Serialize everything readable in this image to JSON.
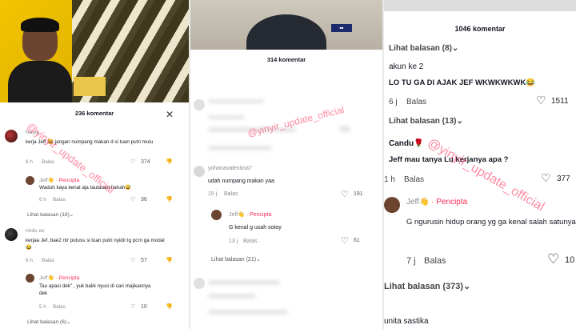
{
  "watermark": "@yinyir_update_official",
  "panel1": {
    "count": "236 komentar",
    "close_icon": "close-icon",
    "c1": {
      "user": "Nayla",
      "text": "kerja Jeff 😂 jangan numpang makan d si tuan putri mulu",
      "time": "6 h",
      "reply": "Balas",
      "likes": "374"
    },
    "r1": {
      "user": "Jeff👋",
      "tag": "· Pencipta",
      "text": "Waduh kaya kenal aja tautauan hahah😅",
      "time": "6 h",
      "reply": "Balas",
      "likes": "36"
    },
    "more1": "Lihat balasan (16)⌄",
    "c2": {
      "user": "rindu ex",
      "text": "kerjaa Jef, bae2 ntr putuss si tuan putri nyidir lg pcrn ga modal 😂",
      "time": "6 h",
      "reply": "Balas",
      "likes": "57"
    },
    "r2": {
      "user": "Jeff👋",
      "tag": "· Pencipta",
      "text": "Tau apasi dek\" , yuk balik nyuci di cari majikannya dek",
      "time": "5 h",
      "reply": "Balas",
      "likes": "10"
    },
    "more2": "Lihat balasan (6)⌄"
  },
  "panel2": {
    "count": "314 komentar",
    "c1": {
      "user": "yohanavalentina7",
      "text": "udah numpang makan yaa",
      "time": "15 j",
      "reply": "Balas",
      "likes": "191"
    },
    "r1": {
      "user": "Jeff👋",
      "tag": "· Pencipta",
      "text": "G kenal g usah sotoy",
      "time": "13 j",
      "reply": "Balas",
      "likes": "61"
    },
    "more": "Lihat balasan (21)⌄"
  },
  "panel3": {
    "count": "1046 komentar",
    "more0": "Lihat balasan (8)⌄",
    "c1": {
      "user": "akun ke 2",
      "text": "LO TU GA DI AJAK JEF WKWKWKWK😂",
      "time": "6 j",
      "reply": "Balas",
      "likes": "1511"
    },
    "more1": "Lihat balasan (13)⌄",
    "c2": {
      "user": "Candu🌹",
      "text": "Jeff mau tanya Lu kerjanya apa ?",
      "time": "1 h",
      "reply": "Balas",
      "likes": "377"
    },
    "r2": {
      "user": "Jeff👋",
      "tag": "· Pencipta",
      "text": "G ngurusin hidup orang yg ga kenal salah satunya",
      "time": "7 j",
      "reply": "Balas",
      "likes": "10"
    },
    "more2": "Lihat balasan (373)⌄",
    "c3": {
      "user": "unita sastika"
    }
  },
  "icons": {
    "like": "heart-icon",
    "dislike": "thumbs-down-icon",
    "close": "close-icon"
  }
}
